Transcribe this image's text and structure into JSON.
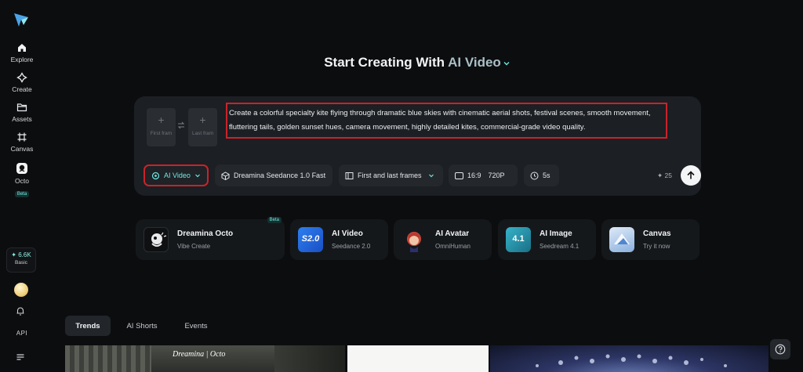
{
  "sidebar": {
    "items": [
      {
        "label": "Explore",
        "icon": "home-icon"
      },
      {
        "label": "Create",
        "icon": "sparkle-icon"
      },
      {
        "label": "Assets",
        "icon": "folder-icon"
      },
      {
        "label": "Canvas",
        "icon": "canvas-icon"
      },
      {
        "label": "Octo",
        "icon": "octo-icon",
        "badge": "Beta"
      }
    ],
    "credits": {
      "value": "6.6K",
      "plan": "Basic"
    },
    "api_label": "API"
  },
  "heading": {
    "prefix": "Start Creating With",
    "mode": "AI Video"
  },
  "composer": {
    "first_frame_label": "First fram",
    "last_frame_label": "Last fram",
    "prompt": "Create a colorful specialty kite flying through dramatic blue skies with cinematic aerial shots, festival scenes, smooth movement, fluttering tails, golden sunset hues, camera movement, highly detailed kites, commercial-grade video quality.",
    "toolbar": {
      "mode": "AI Video",
      "model": "Dreamina Seedance 1.0 Fast",
      "frames": "First and last frames",
      "ratio": "16:9",
      "resolution": "720P",
      "duration": "5s",
      "cost": "25"
    }
  },
  "tools": [
    {
      "name": "Dreamina Octo",
      "sub": "Vibe Create",
      "badge": "Beta"
    },
    {
      "name": "AI Video",
      "sub": "Seedance 2.0",
      "icon_text": "S2.0"
    },
    {
      "name": "AI Avatar",
      "sub": "OmniHuman"
    },
    {
      "name": "AI Image",
      "sub": "Seedream 4.1",
      "icon_text": "4.1"
    },
    {
      "name": "Canvas",
      "sub": "Try it now"
    }
  ],
  "tabs": [
    "Trends",
    "AI Shorts",
    "Events"
  ],
  "gallery": {
    "watermark": "Dreamina | Octo"
  },
  "colors": {
    "accent": "#6fe7e0",
    "highlight_box": "#c9232b",
    "background": "#0c0d0f",
    "panel": "#1c1f23"
  }
}
